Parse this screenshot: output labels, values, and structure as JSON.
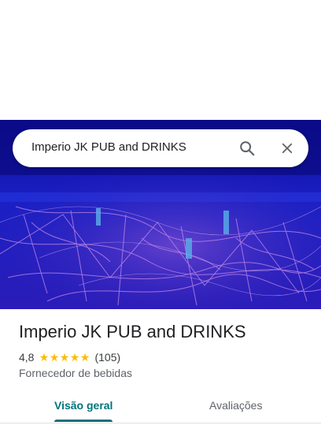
{
  "search": {
    "query": "Imperio JK PUB and DRINKS"
  },
  "icons": {
    "search": "search-icon",
    "close": "close-icon",
    "star": "star-icon"
  },
  "place": {
    "name": "Imperio JK PUB and DRINKS",
    "rating": "4,8",
    "rating_stars": 5,
    "review_count": "(105)",
    "category": "Fornecedor de bebidas"
  },
  "tabs": [
    {
      "label": "Visão geral",
      "active": true
    },
    {
      "label": "Avaliações",
      "active": false
    }
  ],
  "colors": {
    "accent": "#00737b",
    "star": "#fbbc04",
    "photo_bg": "#1a1aa8"
  }
}
